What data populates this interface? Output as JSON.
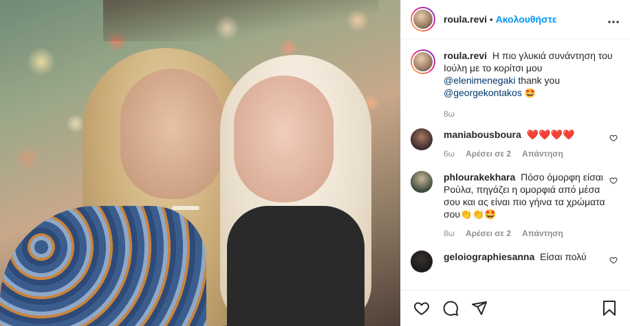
{
  "post": {
    "username": "roula.revi",
    "follow_label": "Ακολουθήστε",
    "dot": "•",
    "more_label": "..."
  },
  "caption": {
    "username": "roula.revi",
    "text_part1": "Η πιο γλυκιά συνάντηση του Ιούλη με το κορίτσι μου",
    "mention1": "@elenimenegaki",
    "text_part2": "thank you",
    "mention2": "@georgekontakos",
    "emoji": "🤩",
    "time": "8ω"
  },
  "comments": [
    {
      "username": "maniabousboura",
      "text": "❤️❤️❤️❤️",
      "time": "6ω",
      "likes": "Αρέσει σε 2",
      "reply_label": "Απάντηση"
    },
    {
      "username": "phlourakekhara",
      "text": "Πόσο όμορφη είσαι Ρούλα, πηγάζει η ομορφιά από μέσα σου και ας είναι πιο γήινα τα χρώματα σου👏👏🤩",
      "time": "8ω",
      "likes": "Αρέσει σε 2",
      "reply_label": "Απάντηση"
    },
    {
      "username": "geloiographiesanna",
      "text": "Είσαι πολύ"
    }
  ],
  "icons": {
    "like": "heart-icon",
    "comment": "comment-icon",
    "share": "share-icon",
    "save": "bookmark-icon",
    "more": "more-icon",
    "comment_like": "heart-outline-icon"
  },
  "colors": {
    "follow": "#0095f6",
    "mention": "#00376b",
    "meta": "#8e8e8e"
  }
}
